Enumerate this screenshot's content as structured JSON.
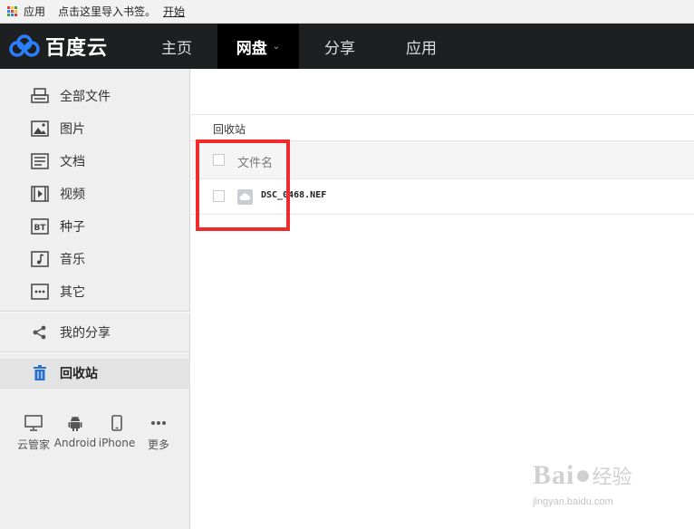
{
  "bookmarks": {
    "apps_label": "应用",
    "import_label": "点击这里导入书签。",
    "start_label": "开始"
  },
  "nav": {
    "logo_text": "百度云",
    "tabs": [
      "主页",
      "网盘",
      "分享",
      "应用"
    ],
    "active_tab": "网盘"
  },
  "sidebar": {
    "items": [
      {
        "label": "全部文件",
        "icon": "printer-icon"
      },
      {
        "label": "图片",
        "icon": "image-icon"
      },
      {
        "label": "文档",
        "icon": "document-icon"
      },
      {
        "label": "视频",
        "icon": "video-icon"
      },
      {
        "label": "种子",
        "icon": "bt-icon"
      },
      {
        "label": "音乐",
        "icon": "music-icon"
      },
      {
        "label": "其它",
        "icon": "more-box-icon"
      },
      {
        "label": "我的分享",
        "icon": "share-icon"
      },
      {
        "label": "回收站",
        "icon": "trash-icon"
      }
    ],
    "active_item": "回收站",
    "apps": [
      {
        "label": "云管家",
        "icon": "monitor-icon"
      },
      {
        "label": "Android",
        "icon": "android-icon"
      },
      {
        "label": "iPhone",
        "icon": "phone-icon"
      },
      {
        "label": "更多",
        "icon": "ellipsis-icon"
      }
    ]
  },
  "main": {
    "breadcrumb": "回收站",
    "column_header": "文件名",
    "files": [
      {
        "name": "DSC_0468.NEF",
        "icon": "cloud-file-icon"
      }
    ]
  },
  "watermark": {
    "brand": "Bai",
    "brand_cn": "经验",
    "url": "jingyan.baidu.com"
  },
  "colors": {
    "nav_bg": "#1d1f21",
    "active_tab_bg": "#000000",
    "highlight_box": "#ef2b2b",
    "trash_blue": "#2a72c9"
  }
}
